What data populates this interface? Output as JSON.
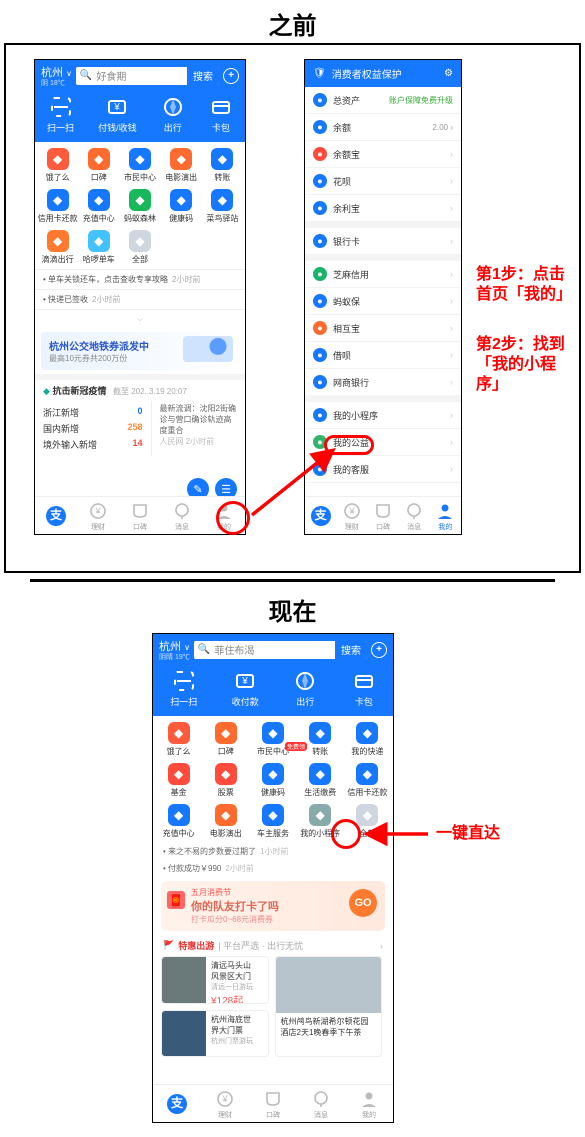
{
  "headings": {
    "before": "之前",
    "now": "现在"
  },
  "annotations": {
    "step1": "第1步：点击\n首页「我的」",
    "step2": "第2步：找到\n「我的小程序」",
    "direct": "一键直达"
  },
  "before_home": {
    "city": "杭州",
    "weather": "阴 18℃",
    "search_placeholder": "好食期",
    "search_btn": "搜索",
    "top4": [
      {
        "key": "scan",
        "label": "扫一扫"
      },
      {
        "key": "pay",
        "label": "付钱/收钱"
      },
      {
        "key": "travel",
        "label": "出行"
      },
      {
        "key": "card",
        "label": "卡包"
      }
    ],
    "apps": [
      {
        "label": "饿了么",
        "color": "#ff5a3c"
      },
      {
        "label": "口碑",
        "color": "#ff6a2e"
      },
      {
        "label": "市民中心",
        "color": "#1677ff"
      },
      {
        "label": "电影演出",
        "color": "#ff6a2e"
      },
      {
        "label": "转账",
        "color": "#1677ff"
      },
      {
        "label": "信用卡还款",
        "color": "#1677ff"
      },
      {
        "label": "充值中心",
        "color": "#1677ff"
      },
      {
        "label": "蚂蚁森林",
        "color": "#18b85a"
      },
      {
        "label": "健康码",
        "color": "#1677ff"
      },
      {
        "label": "菜鸟驿站",
        "color": "#1677ff"
      },
      {
        "label": "滴滴出行",
        "color": "#ff7a2e"
      },
      {
        "label": "哈啰单车",
        "color": "#42c3ff"
      },
      {
        "label": "全部",
        "color": "#cfd6e0"
      }
    ],
    "news": [
      {
        "text": "• 单车关锁还车，点击查收专享攻略",
        "time": "2小时前"
      },
      {
        "text": "• 快递已签收",
        "time": "2小时前"
      }
    ],
    "banner_title": "杭州公交地铁券派发中",
    "banner_sub": "最高10元券共200万份",
    "covid_title": "抗击新冠疫情",
    "covid_sub": "截至 202..3.19 20:07",
    "covid_rows": [
      {
        "k": "浙江新增",
        "v": "0",
        "c": "#1677ff"
      },
      {
        "k": "国内新增",
        "v": "258",
        "c": "#ff8a3c"
      },
      {
        "k": "境外输入新增",
        "v": "14",
        "c": "#ff4a3c"
      }
    ],
    "covid_news": "最新流调：沈阳2街确诊与营口确诊轨迹高度重合",
    "covid_news_time": "人民网 2小时前",
    "tabs": [
      {
        "key": "home",
        "label": ""
      },
      {
        "key": "money",
        "label": "理财"
      },
      {
        "key": "koubei",
        "label": "口碑"
      },
      {
        "key": "msg",
        "label": "消息"
      },
      {
        "key": "mine",
        "label": "我的"
      }
    ]
  },
  "mine": {
    "header": "消费者权益保护",
    "rows": [
      {
        "label": "总资产",
        "color": "#1677ff",
        "right": "账户保障免费升级",
        "rgreen": true
      },
      {
        "label": "余额",
        "color": "#1677ff",
        "right": "2.00 ›"
      },
      {
        "label": "余额宝",
        "color": "#ff4a3c"
      },
      {
        "label": "花呗",
        "color": "#1677ff"
      },
      {
        "label": "余利宝",
        "color": "#1677ff"
      },
      {
        "label": "银行卡",
        "color": "#1677ff",
        "gaptop": true
      },
      {
        "label": "芝麻信用",
        "color": "#19b36b",
        "gaptop": true
      },
      {
        "label": "蚂蚁保",
        "color": "#1677ff"
      },
      {
        "label": "相互宝",
        "color": "#ff6a2e"
      },
      {
        "label": "借呗",
        "color": "#1677ff"
      },
      {
        "label": "网商银行",
        "color": "#1677ff"
      },
      {
        "label": "我的小程序",
        "color": "#1677ff",
        "gaptop": true,
        "target": true
      },
      {
        "label": "我的公益",
        "color": "#33b36b"
      },
      {
        "label": "我的客服",
        "color": "#1677ff"
      }
    ],
    "tabs": [
      {
        "key": "money",
        "label": "理财"
      },
      {
        "key": "koubei",
        "label": "口碑"
      },
      {
        "key": "msg",
        "label": "消息"
      },
      {
        "key": "mine",
        "label": "我的"
      }
    ]
  },
  "now": {
    "city": "杭州",
    "weather": "阴晴 19℃",
    "search_placeholder": "菲住布渴",
    "search_btn": "搜索",
    "top4": [
      {
        "key": "scan",
        "label": "扫一扫"
      },
      {
        "key": "pay",
        "label": "收付款"
      },
      {
        "key": "travel",
        "label": "出行"
      },
      {
        "key": "card",
        "label": "卡包"
      }
    ],
    "apps": [
      {
        "label": "饿了么",
        "color": "#ff5a3c"
      },
      {
        "label": "口碑",
        "color": "#ff6a2e"
      },
      {
        "label": "市民中心",
        "color": "#1677ff",
        "badge": "免费领"
      },
      {
        "label": "转账",
        "color": "#1677ff"
      },
      {
        "label": "我的快递",
        "color": "#1677ff"
      },
      {
        "label": "基金",
        "color": "#ff4a3c"
      },
      {
        "label": "股票",
        "color": "#ff4a3c"
      },
      {
        "label": "健康码",
        "color": "#1677ff"
      },
      {
        "label": "生活缴费",
        "color": "#1677ff"
      },
      {
        "label": "信用卡还款",
        "color": "#1677ff"
      },
      {
        "label": "充值中心",
        "color": "#1677ff"
      },
      {
        "label": "电影演出",
        "color": "#ff6a2e"
      },
      {
        "label": "车主服务",
        "color": "#1677ff"
      },
      {
        "label": "我的小程序",
        "color": "#8aa",
        "target": true
      },
      {
        "label": "全部",
        "color": "#cfd6e0"
      }
    ],
    "news": [
      {
        "text": "• 来之不易的步数要过期了",
        "time": "1小时前"
      },
      {
        "text": "• 付款成功￥990",
        "time": "2小时前"
      }
    ],
    "go_tag": "五月消费节",
    "go_title": "你的队友打卡了吗",
    "go_sub": "打卡瓜分0~68元消费券",
    "go_btn": "GO",
    "tour_tag": "特惠出游",
    "tour_sub": "平台严选 · 出行无忧",
    "cards": [
      {
        "title": "清远马头山\n风景区大门",
        "meta": "清远一日游玩",
        "price": "¥128起",
        "img": "#6a7a7a"
      },
      {
        "title": "杭州海底世\n界大门票",
        "meta": "杭州门票游玩",
        "price": "",
        "img": "#3a5a7a"
      },
      {
        "title": "杭州鸬鸟新湖希尔顿花园\n酒店2天1晚春季下午茶",
        "meta": "",
        "price": "",
        "img": "#b8c4cc"
      }
    ],
    "tabs": [
      {
        "key": "home",
        "label": ""
      },
      {
        "key": "money",
        "label": "理财"
      },
      {
        "key": "koubei",
        "label": "口碑"
      },
      {
        "key": "msg",
        "label": "消息"
      },
      {
        "key": "mine",
        "label": "我的"
      }
    ]
  }
}
